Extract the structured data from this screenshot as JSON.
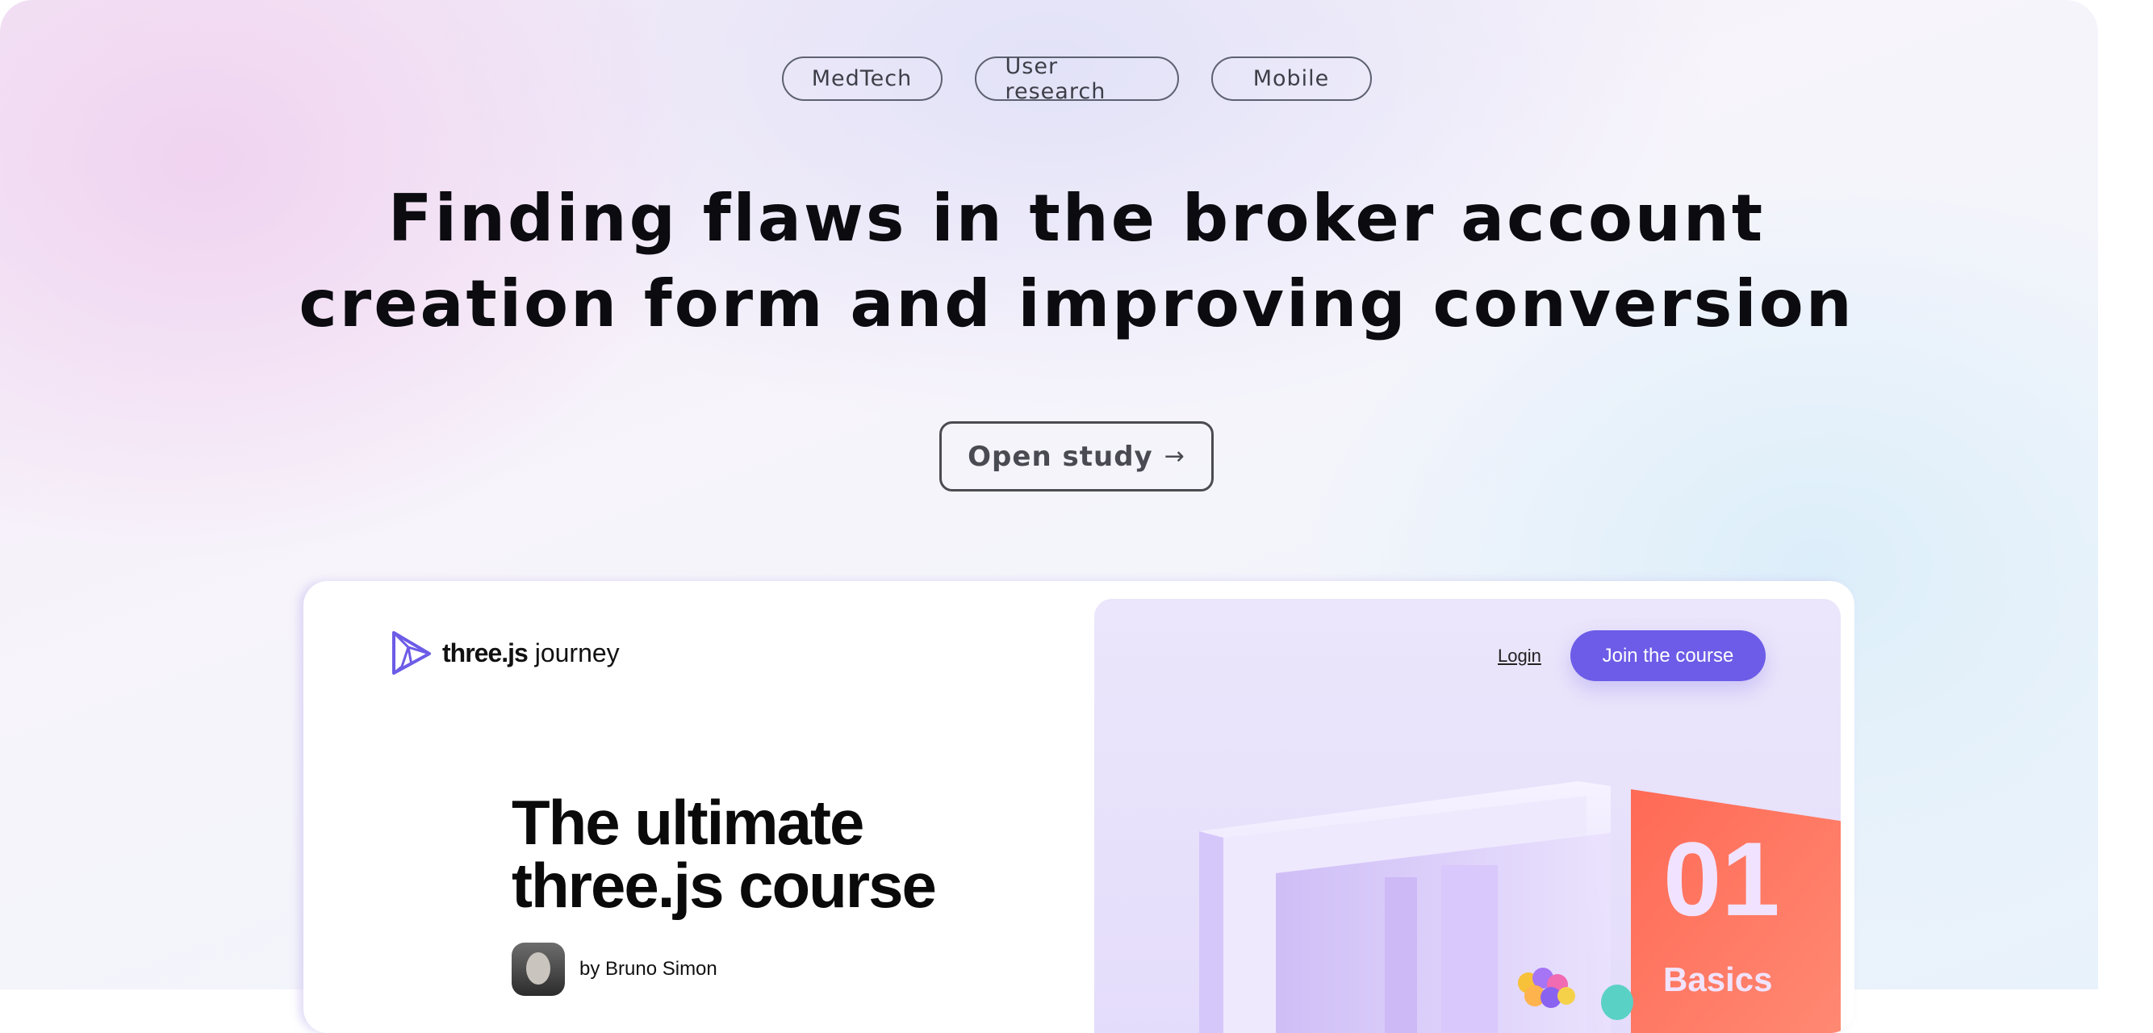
{
  "tags": [
    "MedTech",
    "User research",
    "Mobile"
  ],
  "headline": {
    "line1": "Finding flaws in the broker account",
    "line2": "creation form and improving conversion"
  },
  "cta": {
    "label": "Open study",
    "arrow": "→"
  },
  "preview": {
    "logo": {
      "bold": "three.js",
      "light": " journey"
    },
    "nav": {
      "login": "Login",
      "join": "Join the course"
    },
    "title": {
      "line1": "The ultimate",
      "line2": "three.js course"
    },
    "author": "by Bruno Simon",
    "badge": {
      "number": "01",
      "label": "Basics"
    }
  },
  "colors": {
    "accent": "#6c5ce7",
    "badge": "#f26a55"
  }
}
